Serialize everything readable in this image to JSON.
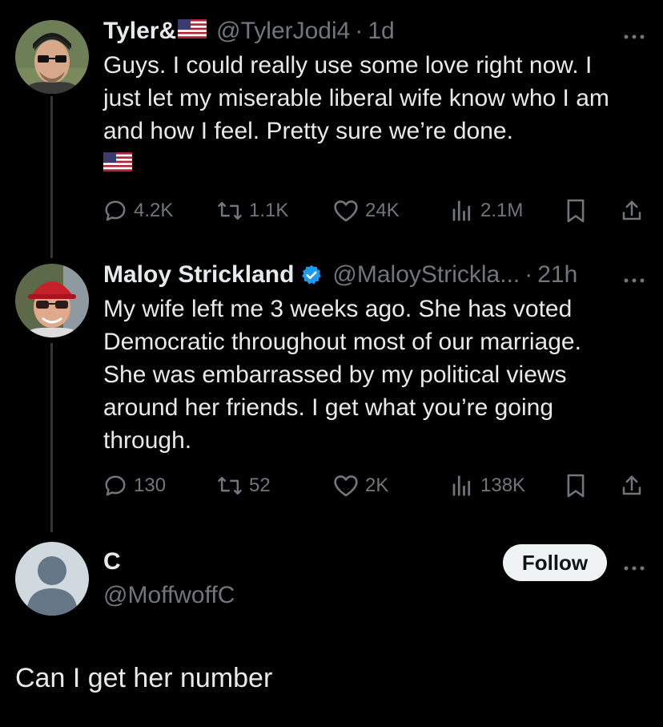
{
  "tweets": [
    {
      "display_name": "Tyler&",
      "name_flag": "us-flag-icon",
      "handle": "@TylerJodi4",
      "time": "1d",
      "text": "Guys. I could really use some love right now. I\njust let my miserable liberal wife know who I am\nand how I feel. Pretty sure we’re done.",
      "text_flag": "us-flag-icon",
      "replies": "4.2K",
      "retweets": "1.1K",
      "likes": "24K",
      "views": "2.1M"
    },
    {
      "display_name": "Maloy Strickland",
      "verified": true,
      "handle": "@MaloyStrickla...",
      "time": "21h",
      "text": "My wife left me 3 weeks ago.  She has voted\nDemocratic throughout most of our marriage.\nShe was embarrassed by my political views\naround her friends. I get what you’re going\nthrough.",
      "replies": "130",
      "retweets": "52",
      "likes": "2K",
      "views": "138K"
    }
  ],
  "reply": {
    "display_name": "C",
    "handle": "@MoffwoffC",
    "follow_label": "Follow",
    "text": "Can I get her number"
  },
  "separator": "·",
  "colors": {
    "background": "#000000",
    "primary_text": "#e7e9ea",
    "secondary_text": "#71767b",
    "verified": "#1d9bf0",
    "thread_line": "#333639"
  }
}
